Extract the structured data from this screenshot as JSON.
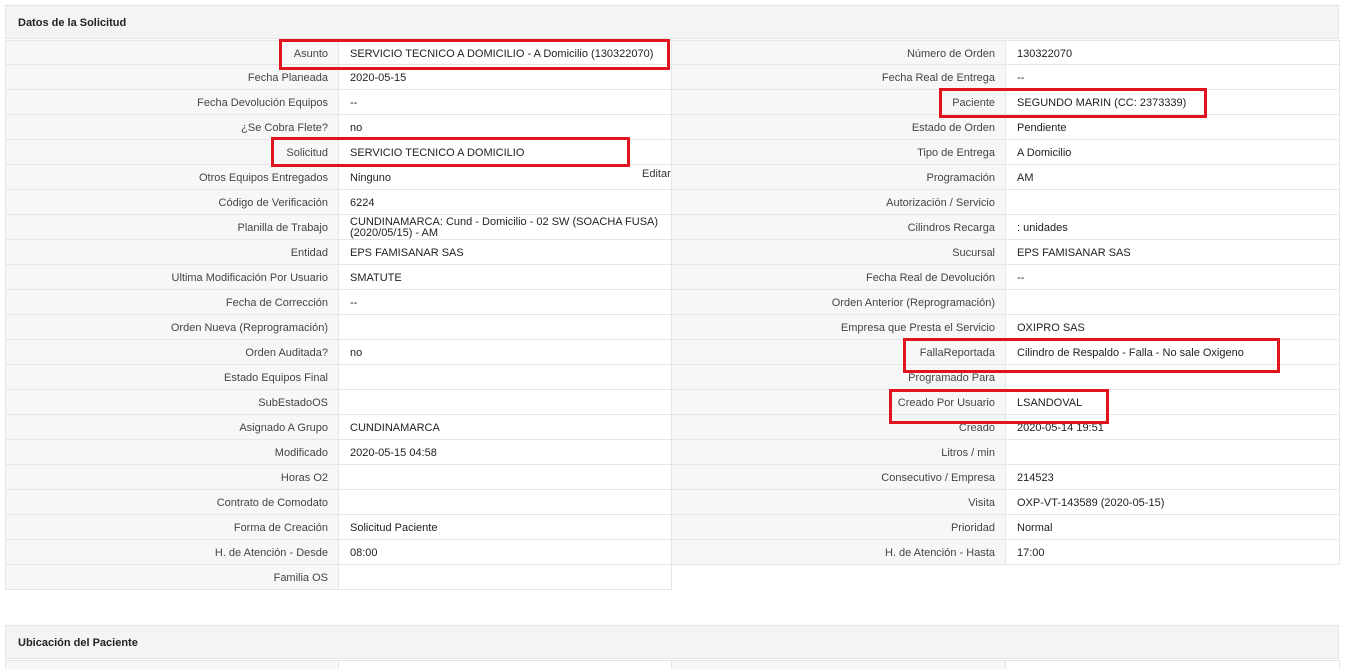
{
  "sections": {
    "solicitud_title": "Datos de la Solicitud",
    "ubicacion_title": "Ubicación del Paciente"
  },
  "edit_label": "Editar",
  "left": [
    {
      "label": "Asunto",
      "value": "SERVICIO TECNICO A DOMICILIO - A Domicilio (130322070)"
    },
    {
      "label": "Fecha Planeada",
      "value": "2020-05-15"
    },
    {
      "label": "Fecha Devolución Equipos",
      "value": "--"
    },
    {
      "label": "¿Se Cobra Flete?",
      "value": "no"
    },
    {
      "label": "Solicitud",
      "value": "SERVICIO TECNICO A DOMICILIO"
    },
    {
      "label": "Otros Equipos Entregados",
      "value": "Ninguno"
    },
    {
      "label": "Código de Verificación",
      "value": "6224"
    },
    {
      "label": "Planilla de Trabajo",
      "value": "CUNDINAMARCA: Cund - Domicilio - 02 SW (SOACHA FUSA) (2020/05/15) - AM"
    },
    {
      "label": "Entidad",
      "value": "EPS FAMISANAR SAS"
    },
    {
      "label": "Ultima Modificación Por Usuario",
      "value": "SMATUTE"
    },
    {
      "label": "Fecha de Corrección",
      "value": "--"
    },
    {
      "label": "Orden Nueva (Reprogramación)",
      "value": ""
    },
    {
      "label": "Orden Auditada?",
      "value": "no"
    },
    {
      "label": "Estado Equipos Final",
      "value": ""
    },
    {
      "label": "SubEstadoOS",
      "value": ""
    },
    {
      "label": "Asignado A Grupo",
      "value": "CUNDINAMARCA"
    },
    {
      "label": "Modificado",
      "value": "2020-05-15 04:58"
    },
    {
      "label": "Horas O2",
      "value": ""
    },
    {
      "label": "Contrato de Comodato",
      "value": ""
    },
    {
      "label": "Forma de Creación",
      "value": "Solicitud Paciente"
    },
    {
      "label": "H. de Atención - Desde",
      "value": "08:00"
    },
    {
      "label": "Familia OS",
      "value": ""
    }
  ],
  "right": [
    {
      "label": "Número de Orden",
      "value": "130322070"
    },
    {
      "label": "Fecha Real de Entrega",
      "value": "--"
    },
    {
      "label": "Paciente",
      "value": "SEGUNDO MARIN (CC: 2373339)"
    },
    {
      "label": "Estado de Orden",
      "value": "Pendiente"
    },
    {
      "label": "Tipo de Entrega",
      "value": "A Domicilio"
    },
    {
      "label": "Programación",
      "value": "AM"
    },
    {
      "label": "Autorización / Servicio",
      "value": ""
    },
    {
      "label": "Cilindros Recarga",
      "value": ": unidades"
    },
    {
      "label": "Sucursal",
      "value": "EPS FAMISANAR SAS"
    },
    {
      "label": "Fecha Real de Devolución",
      "value": "--"
    },
    {
      "label": "Orden Anterior (Reprogramación)",
      "value": ""
    },
    {
      "label": "Empresa que Presta el Servicio",
      "value": "OXIPRO SAS"
    },
    {
      "label": "FallaReportada",
      "value": "Cilindro de Respaldo - Falla - No sale Oxigeno"
    },
    {
      "label": "Programado Para",
      "value": ""
    },
    {
      "label": "Creado Por Usuario",
      "value": "LSANDOVAL"
    },
    {
      "label": "Creado",
      "value": "2020-05-14 19:51"
    },
    {
      "label": "Litros / min",
      "value": ""
    },
    {
      "label": "Consecutivo / Empresa",
      "value": "214523"
    },
    {
      "label": "Visita",
      "value": "OXP-VT-143589 (2020-05-15)"
    },
    {
      "label": "Prioridad",
      "value": "Normal"
    },
    {
      "label": "H. de Atención - Hasta",
      "value": "17:00"
    }
  ],
  "colors": {
    "highlight": "#e0141f",
    "label_bg": "#f7f7f7",
    "header_bg": "#f4f4f4",
    "border": "#e6e6e6"
  }
}
